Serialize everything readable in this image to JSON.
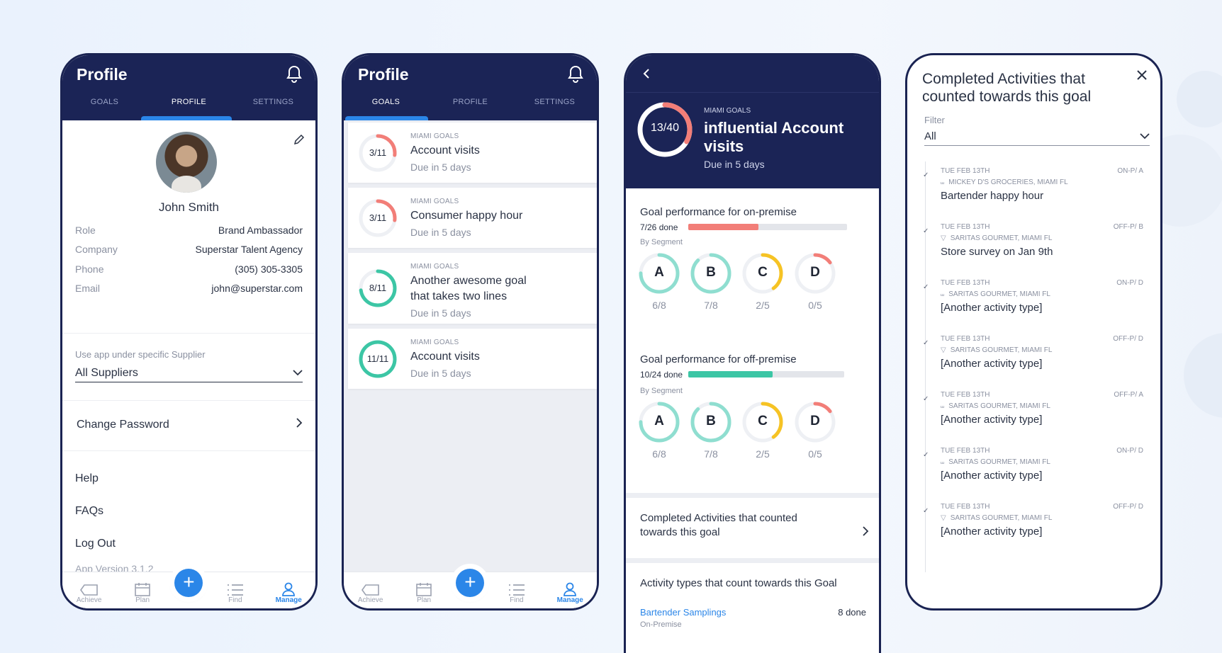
{
  "screen1": {
    "title": "Profile",
    "tabs": [
      "GOALS",
      "PROFILE",
      "SETTINGS"
    ],
    "name": "John Smith",
    "fields": [
      {
        "k": "Role",
        "v": "Brand Ambassador"
      },
      {
        "k": "Company",
        "v": "Superstar Talent Agency"
      },
      {
        "k": "Phone",
        "v": "(305) 305-3305"
      },
      {
        "k": "Email",
        "v": "john@superstar.com"
      }
    ],
    "supplier_label": "Use app under specific Supplier",
    "supplier_value": "All Suppliers",
    "change_password": "Change Password",
    "help": "Help",
    "faqs": "FAQs",
    "logout": "Log Out",
    "version": "App Version 3.1.2"
  },
  "nav": [
    "Achieve",
    "Plan",
    "Find",
    "Manage"
  ],
  "fab": "+",
  "screen2": {
    "title": "Profile",
    "tabs": [
      "GOALS",
      "PROFILE",
      "SETTINGS"
    ],
    "goals": [
      {
        "tag": "MIAMI GOALS",
        "name": "Account visits",
        "name2": "",
        "due": "Due in 5 days",
        "count": "3/11",
        "progress": 0.27,
        "color": "#f27e78"
      },
      {
        "tag": "MIAMI GOALS",
        "name": "Consumer happy hour",
        "name2": "",
        "due": "Due in 5 days",
        "count": "3/11",
        "progress": 0.27,
        "color": "#f27e78"
      },
      {
        "tag": "MIAMI GOALS",
        "name": "Another awesome goal",
        "name2": "that takes two lines",
        "due": "Due in 5 days",
        "count": "8/11",
        "progress": 0.73,
        "color": "#3cc6a5"
      },
      {
        "tag": "MIAMI GOALS",
        "name": "Account visits",
        "name2": "",
        "due": "Due in 5 days",
        "count": "11/11",
        "progress": 1.0,
        "color": "#3cc6a5"
      }
    ]
  },
  "screen3": {
    "tag": "MIAMI GOALS",
    "title1": "influential Account",
    "title2": "visits",
    "due": "Due in 5 days",
    "count": "13/40",
    "progress": 0.33,
    "on": {
      "title": "Goal performance for on-premise",
      "done": "7/26 done",
      "progress": 0.44,
      "color": "#f27e78"
    },
    "off": {
      "title": "Goal performance for off-premise",
      "done": "10/24 done",
      "progress": 0.54,
      "color": "#3cc6a5"
    },
    "by_segment": "By Segment",
    "segments": [
      {
        "letter": "A",
        "label": "6/8",
        "progress": 0.75,
        "color": "#8fded0"
      },
      {
        "letter": "B",
        "label": "7/8",
        "progress": 0.875,
        "color": "#8fded0"
      },
      {
        "letter": "C",
        "label": "2/5",
        "progress": 0.4,
        "color": "#f6c324"
      },
      {
        "letter": "D",
        "label": "0/5",
        "progress": 0.15,
        "color": "#f27e78"
      }
    ],
    "completed1": "Completed Activities that counted",
    "completed2": "towards this goal",
    "types_title": "Activity types that count towards this Goal",
    "type_name": "Bartender Samplings",
    "type_sub": "On-Premise",
    "type_done": "8 done"
  },
  "screen4": {
    "title1": "Completed Activities that",
    "title2": "counted towards this goal",
    "filter_label": "Filter",
    "filter_value": "All",
    "activities": [
      {
        "date": "TUE FEB 13TH",
        "code": "ON-P/ A",
        "store": "MICKEY D'S GROCERIES, MIAMI FL",
        "name": "Bartender happy hour",
        "icon": "cart"
      },
      {
        "date": "TUE FEB 13TH",
        "code": "OFF-P/ B",
        "store": "SARITAS GOURMET, MIAMI FL",
        "name": "Store survey on Jan 9th",
        "icon": "glass"
      },
      {
        "date": "TUE FEB 13TH",
        "code": "ON-P/ D",
        "store": "SARITAS GOURMET, MIAMI FL",
        "name": "[Another activity type]",
        "icon": "cart"
      },
      {
        "date": "TUE FEB 13TH",
        "code": "OFF-P/ D",
        "store": "SARITAS GOURMET, MIAMI FL",
        "name": "[Another activity type]",
        "icon": "glass"
      },
      {
        "date": "TUE FEB 13TH",
        "code": "OFF-P/ A",
        "store": "SARITAS GOURMET, MIAMI FL",
        "name": "[Another activity type]",
        "icon": "cart"
      },
      {
        "date": "TUE FEB 13TH",
        "code": "ON-P/ D",
        "store": "SARITAS GOURMET, MIAMI FL",
        "name": "[Another activity type]",
        "icon": "cart"
      },
      {
        "date": "TUE FEB 13TH",
        "code": "OFF-P/ D",
        "store": "SARITAS GOURMET, MIAMI FL",
        "name": "[Another activity type]",
        "icon": "glass"
      }
    ]
  }
}
